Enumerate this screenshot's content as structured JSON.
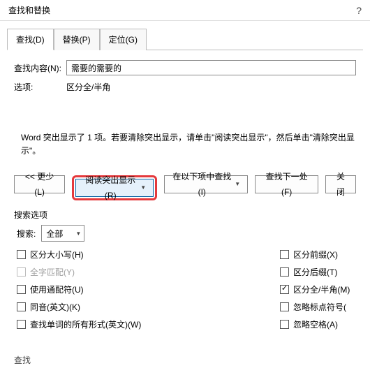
{
  "titlebar": {
    "title": "查找和替换",
    "help": "?"
  },
  "tabs": {
    "find": "查找(D)",
    "replace": "替换(P)",
    "goto": "定位(G)"
  },
  "row_find_label": "查找内容(N):",
  "row_find_value": "需要的需要的",
  "row_options_label": "选项:",
  "row_options_value": "区分全/半角",
  "message": "Word 突出显示了 1 项。若要清除突出显示，请单击\"阅读突出显示\"，然后单击\"清除突出显示\"。",
  "buttons": {
    "less": "<< 更少(L)",
    "highlight": "阅读突出显示(R)",
    "findin": "在以下项中查找(I)",
    "findnext": "查找下一处(F)",
    "close": "关闭"
  },
  "search_options_label": "搜索选项",
  "search_label": "搜索:",
  "search_value": "全部",
  "checks_left": [
    {
      "label": "区分大小写(H)",
      "checked": false,
      "disabled": false
    },
    {
      "label": "全字匹配(Y)",
      "checked": false,
      "disabled": true
    },
    {
      "label": "使用通配符(U)",
      "checked": false,
      "disabled": false
    },
    {
      "label": "同音(英文)(K)",
      "checked": false,
      "disabled": false
    },
    {
      "label": "查找单词的所有形式(英文)(W)",
      "checked": false,
      "disabled": false
    }
  ],
  "checks_right": [
    {
      "label": "区分前缀(X)",
      "checked": false
    },
    {
      "label": "区分后缀(T)",
      "checked": false
    },
    {
      "label": "区分全/半角(M)",
      "checked": true
    },
    {
      "label": "忽略标点符号(",
      "checked": false
    },
    {
      "label": "忽略空格(A)",
      "checked": false
    }
  ],
  "footer_label": "查找"
}
